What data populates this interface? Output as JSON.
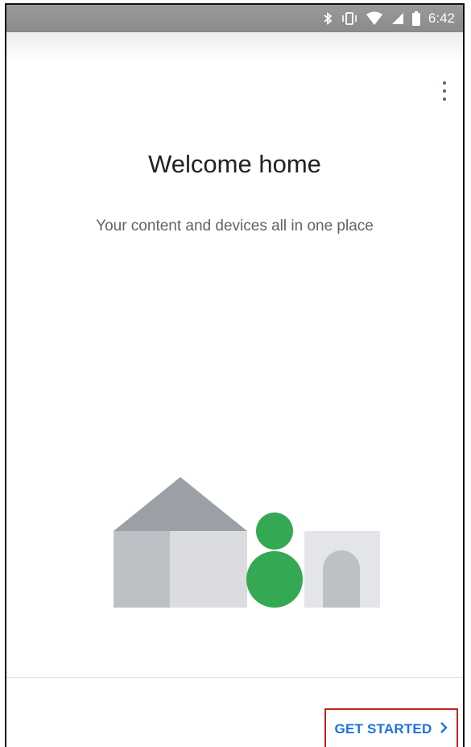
{
  "status_bar": {
    "time": "6:42",
    "icons": [
      "bluetooth-icon",
      "vibrate-icon",
      "wifi-icon",
      "signal-icon",
      "battery-icon"
    ]
  },
  "app_bar": {
    "menu_icon": "overflow-menu-icon"
  },
  "welcome": {
    "title": "Welcome home",
    "subtitle": "Your content and devices all in one place"
  },
  "footer": {
    "get_started_label": "GET STARTED",
    "chevron_icon": "chevron-right-icon"
  },
  "colors": {
    "accent": "#1a73e8",
    "person_green": "#34a853",
    "roof_gray": "#9aa0a6",
    "wall_dark": "#bdc1c6",
    "wall_light": "#dadce0",
    "highlight_border": "#c5221f"
  }
}
